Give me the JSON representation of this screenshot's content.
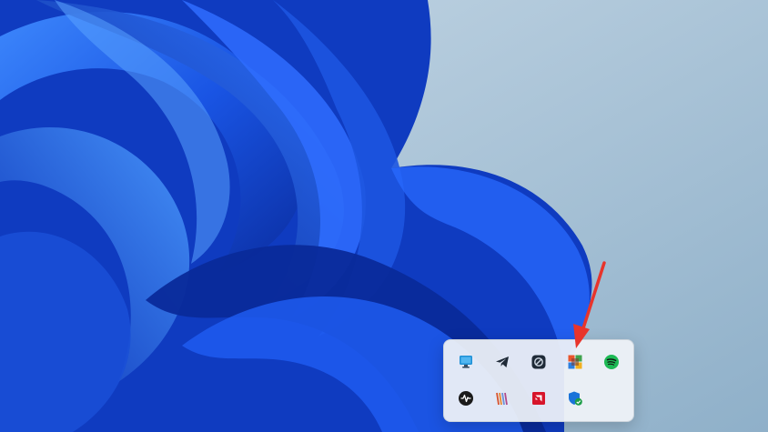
{
  "desktop": {
    "wallpaper": "windows-11-bloom",
    "colors": {
      "sky": "#a9c4da",
      "bloom_dark": "#0c2fa8",
      "bloom_mid": "#1a56e6",
      "bloom_light": "#3a86ff"
    }
  },
  "tray_overflow": {
    "icons": [
      {
        "icon": "monitor-icon",
        "color": "#1e90d6"
      },
      {
        "icon": "telegram-icon",
        "color": "#1f2a37"
      },
      {
        "icon": "app-circle-icon",
        "color": "#1f2a37"
      },
      {
        "icon": "windows-color-icon",
        "color": "#e8552d"
      },
      {
        "icon": "spotify-icon",
        "color": "#1db954"
      },
      {
        "icon": "activity-icon",
        "color": "#1a1a1a"
      },
      {
        "icon": "stripes-icon",
        "color": "#d9532b"
      },
      {
        "icon": "amd-icon",
        "color": "#d7142a"
      },
      {
        "icon": "security-shield-icon",
        "color": "#1a73d9"
      }
    ]
  },
  "annotation": {
    "color": "#e8342b"
  }
}
